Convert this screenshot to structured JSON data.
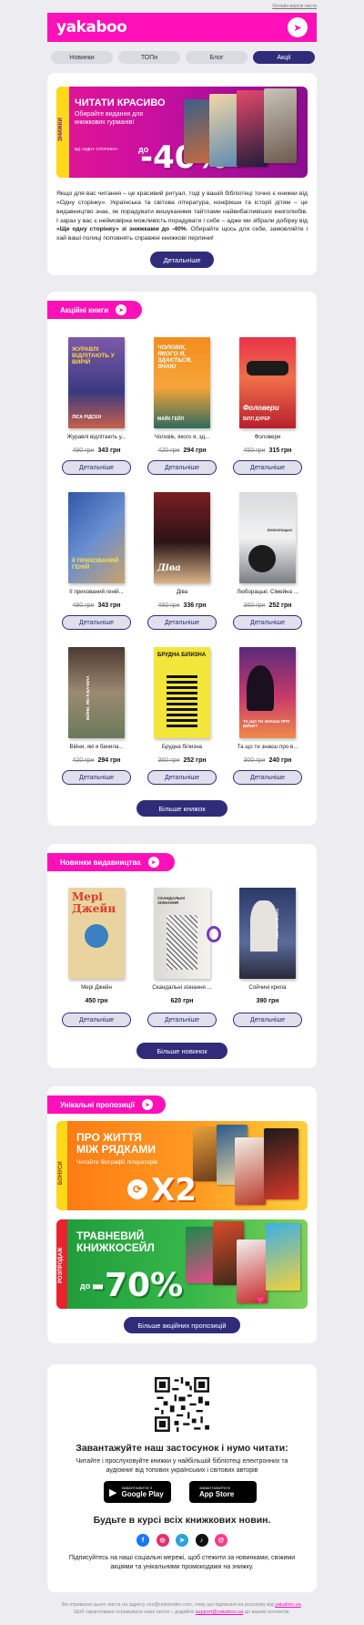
{
  "top_link": "Онлайн-версія листа",
  "header": {
    "logo": "yakaboo"
  },
  "nav": [
    "Новинки",
    "ТОПи",
    "Блог",
    "Акції"
  ],
  "hero": {
    "side": "ЗНИЖКИ",
    "title": "ЧИТАТИ КРАСИВО",
    "subtitle": "Обирайте видання для книжкових гурманів!",
    "brand": "ВД «ОДНУ СТОРІНКУ»",
    "prefix": "до",
    "discount": "-40%",
    "text_before": "Якщо для вас читання – це красивий ритуал, тоді у вашій бібліотеці точно є книжки від «Одну сторінку». Українська та світова література, нонфікшн та історії дітям – це видавництво знає, як порадувати вишуканими тайтлами найвибагливіших книголюбів. І зараз у вас є неймовірна можливість порадувати і себе – адже ми зібрали добірку від ",
    "text_bold": "«Ще одну сторінку» зі знижками до -40%",
    "text_after": ". Обирайте щось для себе, замовляйте і хай ваші полиці поповнять справжні книжкові перлини!",
    "button": "Детальніше"
  },
  "sale": {
    "tag": "Акційні книги",
    "button_more": "Більше книжок",
    "books": [
      {
        "title": "Журавлі відлітають у...",
        "old": "490 грн",
        "new": "343 грн",
        "cover_text": "ЖУРАВЛІ ВІДЛІТАЮТЬ У ВИРІЙ",
        "author": "ЛІСА РІДСЕН"
      },
      {
        "title": "Чоловік, якого я, зд...",
        "old": "420 грн",
        "new": "294 грн",
        "cover_text": "ЧОЛОВІК, ЯКОГО Я, ЗДАЄТЬСЯ, ЗНАЮ",
        "author": "МАЙК ГЕЙЛ"
      },
      {
        "title": "Фоловери",
        "old": "450 грн",
        "new": "315 грн",
        "cover_text": "Фоловери",
        "author": "ВІЛЛ ДУРЕР"
      },
      {
        "title": "Її прихований геній...",
        "old": "490 грн",
        "new": "343 грн",
        "cover_text": "ЇЇ ПРИХОВАНИЙ ГЕНІЙ",
        "author": ""
      },
      {
        "title": "Діва",
        "old": "480 грн",
        "new": "336 грн",
        "cover_text": "Діва",
        "author": ""
      },
      {
        "title": "Люборацькі. Сімейна ...",
        "old": "360 грн",
        "new": "252 грн",
        "cover_text": "ЛЮБОРАЦЬКІ",
        "author": ""
      },
      {
        "title": "Війни, які я бачила...",
        "old": "420 грн",
        "new": "294 грн",
        "cover_text": "ВІЙНИ, ЯКІ Я БАЧИЛА",
        "author": ""
      },
      {
        "title": "Брудна білизна",
        "old": "360 грн",
        "new": "252 грн",
        "cover_text": "БРУДНА БІЛИЗНА",
        "author": ""
      },
      {
        "title": "Та що ти знаєш про в...",
        "old": "300 грн",
        "new": "240 грн",
        "cover_text": "ТА ЩО ТИ ЗНАЄШ ПРО ВІЙНУ?",
        "author": ""
      }
    ]
  },
  "novelties": {
    "tag": "Новинки видавництва",
    "button_more": "Більше новинок",
    "books": [
      {
        "title": "Мері Джейн",
        "price": "450 грн",
        "cover_text": "Мері Джейн"
      },
      {
        "title": "Скандальні зізнання ...",
        "price": "620 грн",
        "cover_text": "СКАНДАЛЬНІ ЗІЗНАННЯ"
      },
      {
        "title": "Сойчині крила",
        "price": "390 грн",
        "cover_text": "СОЙЧИНІ КРИЛА"
      }
    ]
  },
  "unique": {
    "tag": "Унікальні пропозиції",
    "button_more": "Більше акційних пропозицій",
    "promo1": {
      "side": "БОНУСИ",
      "title1": "ПРО ЖИТТЯ",
      "title2": "МІЖ РЯДКАМИ",
      "subtitle": "Читайте біографії літераторів",
      "value": "X2"
    },
    "promo2": {
      "side": "РОЗПРОДАЖ",
      "title1": "ТРАВНЕВИЙ",
      "title2": "КНИЖКОСЕЙЛ",
      "prefix": "до",
      "value": "-70%"
    }
  },
  "footer": {
    "app_heading": "Завантажуйте наш застосунок і нумо читати:",
    "app_text": "Читайте і прослуховуйте книжки у найбільшій бібліотеці електронних та аудіокниг від топових українських і світових авторів",
    "google_small": "ЗАВАНТАЖИТИ З",
    "google_big": "Google Play",
    "apple_small": "ЗАВАНТАЖИТИ В",
    "apple_big": "App Store",
    "news_heading": "Будьте в курсі всіх книжкових новин.",
    "news_text": "Підписуйтесь на наші соціальні мережі, щоб стежити за новинками, свіжими акціями та унікальними промокодами на знижку.",
    "socials": [
      "facebook-icon",
      "instagram-icon",
      "telegram-icon",
      "tiktok-icon",
      "threads-icon"
    ]
  },
  "bottom": {
    "line1": "Ви отримали цього листа на адресу xxx@unisender.com, тому що підписані на розсилку від",
    "link1": "yakaboo.ua",
    "line2": " Щоб гарантовано отримувати наші листи – додайте ",
    "link2": "support@yakaboo.ua",
    "line3": " до ваших контактів."
  }
}
